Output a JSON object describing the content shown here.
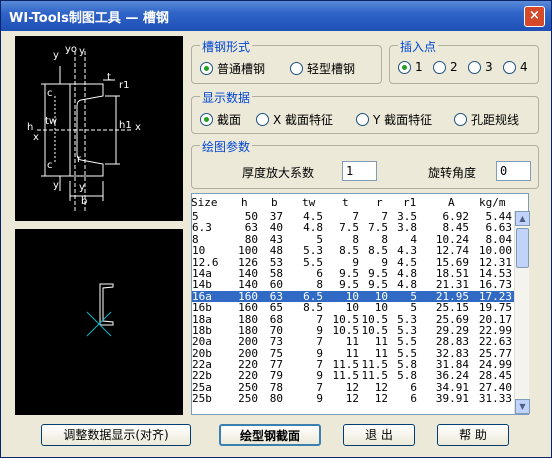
{
  "window": {
    "title": "WI-Tools制图工具 — 槽钢",
    "close_glyph": "×"
  },
  "diagram": {
    "labels": {
      "yo": "yo",
      "y_top": "y",
      "y_top2": "y",
      "tl": "t",
      "r1": "r1",
      "h": "h",
      "h1": "h1",
      "tw": "tw",
      "x_left": "x",
      "x_right": "x",
      "c_top": "c",
      "c_bot": "c",
      "r": "r",
      "y_bot": "y",
      "y_bot2": "y",
      "b": "b"
    }
  },
  "groups": {
    "section_type": {
      "legend": "槽钢形式",
      "options": [
        "普通槽钢",
        "轻型槽钢"
      ],
      "selected": 0
    },
    "insert_point": {
      "legend": "插入点",
      "options": [
        "1",
        "2",
        "3",
        "4"
      ],
      "selected": 0
    },
    "display_data": {
      "legend": "显示数据",
      "options": [
        "截面",
        "X 截面特征",
        "Y 截面特征",
        "孔距规线"
      ],
      "selected": 0
    },
    "draw_params": {
      "legend": "绘图参数",
      "thickness_label": "厚度放大系数",
      "thickness_value": "1",
      "rotation_label": "旋转角度",
      "rotation_value": "0"
    }
  },
  "table": {
    "headers": [
      "Size",
      "h",
      "b",
      "tw",
      "t",
      "r",
      "r1",
      "A",
      "kg/m"
    ],
    "selected_index": 7,
    "rows": [
      [
        "5",
        "50",
        "37",
        "4.5",
        "7",
        "7",
        "3.5",
        "6.92",
        "5.44"
      ],
      [
        "6.3",
        "63",
        "40",
        "4.8",
        "7.5",
        "7.5",
        "3.8",
        "8.45",
        "6.63"
      ],
      [
        "8",
        "80",
        "43",
        "5",
        "8",
        "8",
        "4",
        "10.24",
        "8.04"
      ],
      [
        "10",
        "100",
        "48",
        "5.3",
        "8.5",
        "8.5",
        "4.3",
        "12.74",
        "10.00"
      ],
      [
        "12.6",
        "126",
        "53",
        "5.5",
        "9",
        "9",
        "4.5",
        "15.69",
        "12.31"
      ],
      [
        "14a",
        "140",
        "58",
        "6",
        "9.5",
        "9.5",
        "4.8",
        "18.51",
        "14.53"
      ],
      [
        "14b",
        "140",
        "60",
        "8",
        "9.5",
        "9.5",
        "4.8",
        "21.31",
        "16.73"
      ],
      [
        "16a",
        "160",
        "63",
        "6.5",
        "10",
        "10",
        "5",
        "21.95",
        "17.23"
      ],
      [
        "16b",
        "160",
        "65",
        "8.5",
        "10",
        "10",
        "5",
        "25.15",
        "19.75"
      ],
      [
        "18a",
        "180",
        "68",
        "7",
        "10.5",
        "10.5",
        "5.3",
        "25.69",
        "20.17"
      ],
      [
        "18b",
        "180",
        "70",
        "9",
        "10.5",
        "10.5",
        "5.3",
        "29.29",
        "22.99"
      ],
      [
        "20a",
        "200",
        "73",
        "7",
        "11",
        "11",
        "5.5",
        "28.83",
        "22.63"
      ],
      [
        "20b",
        "200",
        "75",
        "9",
        "11",
        "11",
        "5.5",
        "32.83",
        "25.77"
      ],
      [
        "22a",
        "220",
        "77",
        "7",
        "11.5",
        "11.5",
        "5.8",
        "31.84",
        "24.99"
      ],
      [
        "22b",
        "220",
        "79",
        "9",
        "11.5",
        "11.5",
        "5.8",
        "36.24",
        "28.45"
      ],
      [
        "25a",
        "250",
        "78",
        "7",
        "12",
        "12",
        "6",
        "34.91",
        "27.40"
      ],
      [
        "25b",
        "250",
        "80",
        "9",
        "12",
        "12",
        "6",
        "39.91",
        "31.33"
      ]
    ]
  },
  "buttons": {
    "adjust": "调整数据显示(对齐)",
    "draw": "绘型钢截面",
    "exit": "退 出",
    "help": "帮 助"
  }
}
